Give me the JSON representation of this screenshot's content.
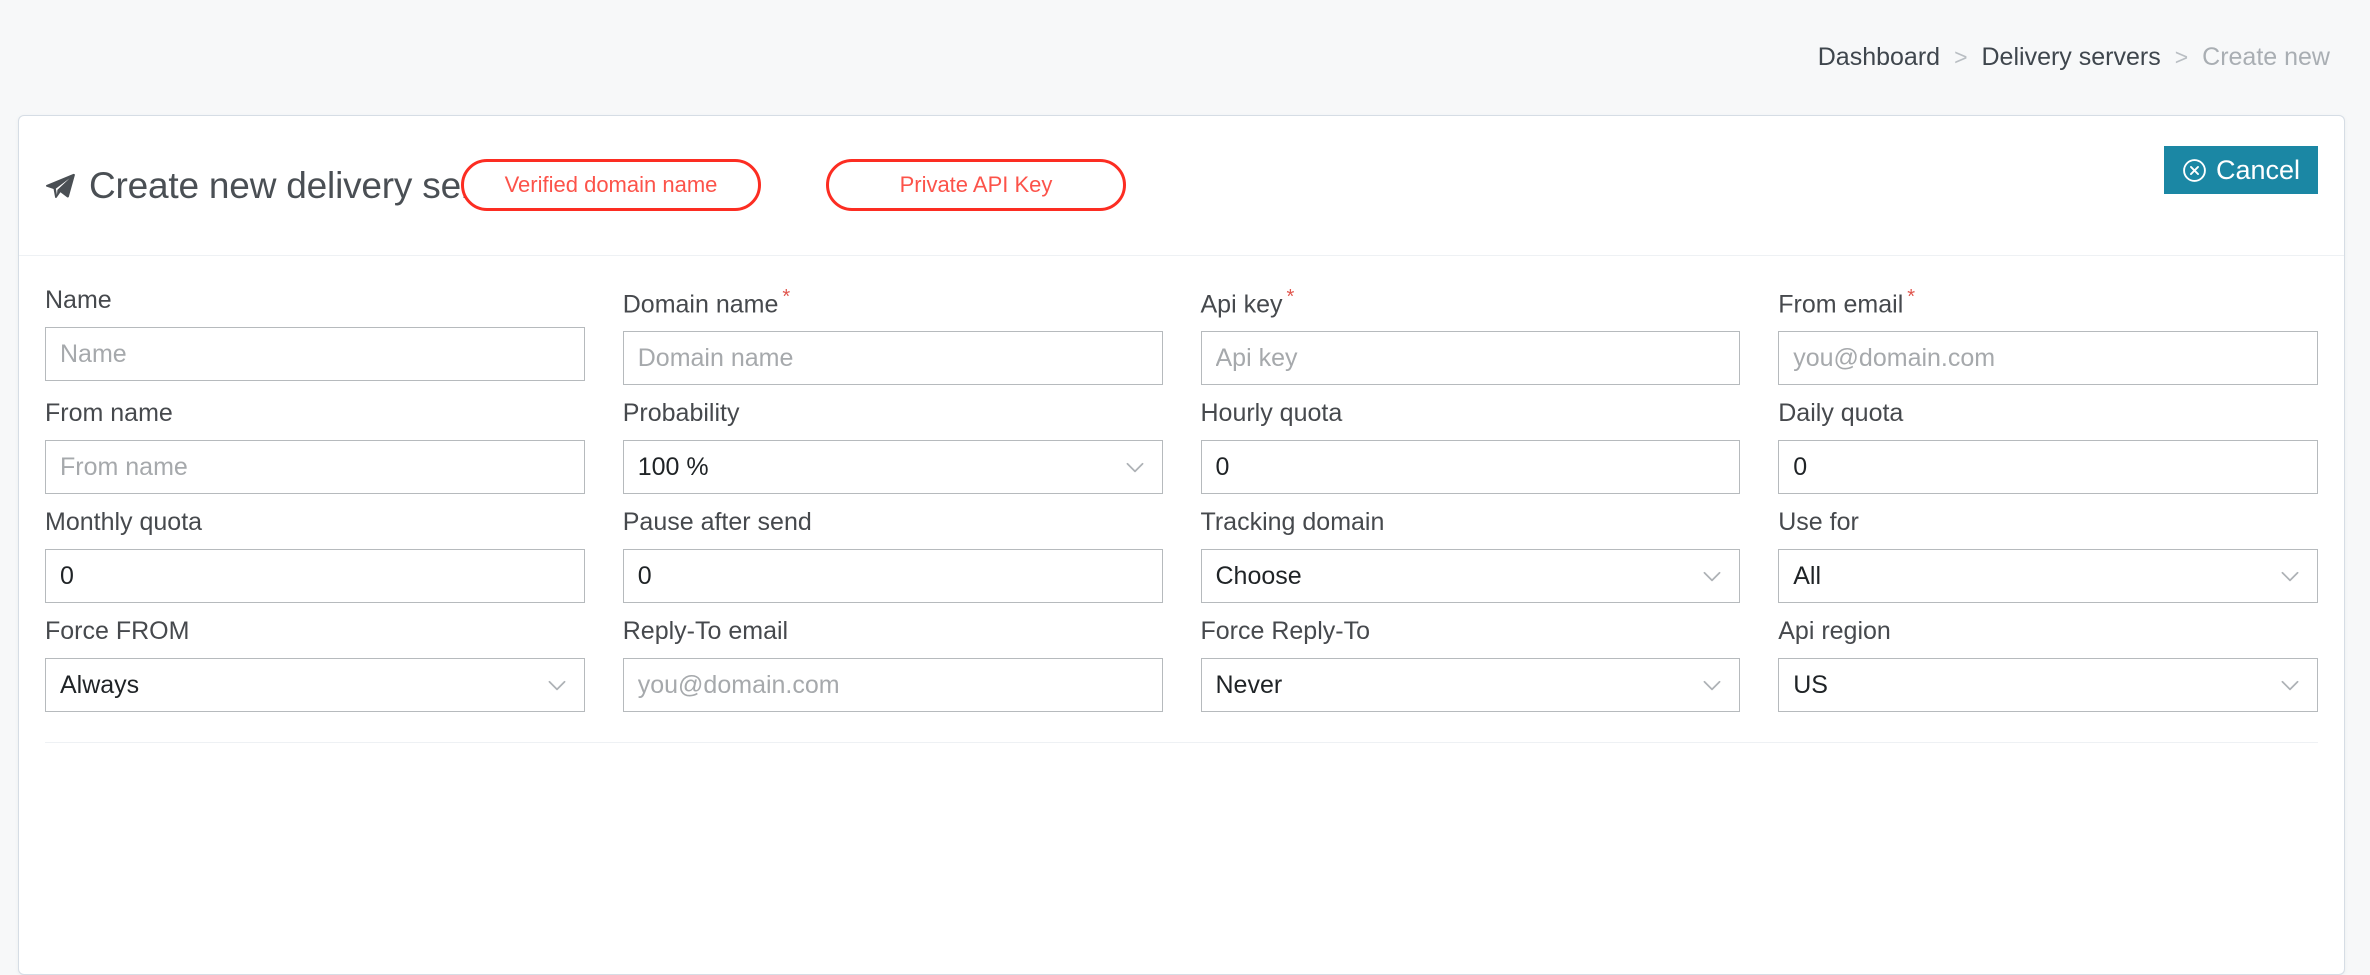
{
  "breadcrumb": {
    "items": [
      {
        "label": "Dashboard",
        "current": false
      },
      {
        "label": "Delivery servers",
        "current": false
      },
      {
        "label": "Create new",
        "current": true
      }
    ],
    "separator": ">"
  },
  "header": {
    "title": "Create new delivery server",
    "icon": "paper-plane-icon",
    "pills": [
      {
        "label": "Verified domain name",
        "name": "verified-domain-name-button"
      },
      {
        "label": "Private API Key",
        "name": "private-api-key-button"
      }
    ],
    "cancel": {
      "label": "Cancel",
      "icon": "circle-x-icon"
    }
  },
  "colors": {
    "accent_teal": "#1b87a4",
    "pill_border_red": "#fc2d22",
    "pill_text_red": "#fc534a",
    "required_red": "#e0554d",
    "page_background": "#f7f8f9",
    "card_border": "#d6dde5",
    "input_border": "#b6babd"
  },
  "form": {
    "rows": [
      [
        {
          "label": "Name",
          "required": false,
          "type": "text",
          "value": "",
          "placeholder": "Name",
          "name": "name"
        },
        {
          "label": "Domain name",
          "required": true,
          "type": "text",
          "value": "",
          "placeholder": "Domain name",
          "name": "domain-name"
        },
        {
          "label": "Api key",
          "required": true,
          "type": "text",
          "value": "",
          "placeholder": "Api key",
          "name": "api-key"
        },
        {
          "label": "From email",
          "required": true,
          "type": "text",
          "value": "",
          "placeholder": "you@domain.com",
          "name": "from-email"
        }
      ],
      [
        {
          "label": "From name",
          "required": false,
          "type": "text",
          "value": "",
          "placeholder": "From name",
          "name": "from-name"
        },
        {
          "label": "Probability",
          "required": false,
          "type": "select",
          "value": "100 %",
          "name": "probability"
        },
        {
          "label": "Hourly quota",
          "required": false,
          "type": "text",
          "value": "0",
          "placeholder": "",
          "name": "hourly-quota"
        },
        {
          "label": "Daily quota",
          "required": false,
          "type": "text",
          "value": "0",
          "placeholder": "",
          "name": "daily-quota"
        }
      ],
      [
        {
          "label": "Monthly quota",
          "required": false,
          "type": "text",
          "value": "0",
          "placeholder": "",
          "name": "monthly-quota"
        },
        {
          "label": "Pause after send",
          "required": false,
          "type": "text",
          "value": "0",
          "placeholder": "",
          "name": "pause-after-send"
        },
        {
          "label": "Tracking domain",
          "required": false,
          "type": "select",
          "value": "Choose",
          "name": "tracking-domain"
        },
        {
          "label": "Use for",
          "required": false,
          "type": "select",
          "value": "All",
          "name": "use-for"
        }
      ],
      [
        {
          "label": "Force FROM",
          "required": false,
          "type": "select",
          "value": "Always",
          "name": "force-from"
        },
        {
          "label": "Reply-To email",
          "required": false,
          "type": "text",
          "value": "",
          "placeholder": "you@domain.com",
          "name": "reply-to-email"
        },
        {
          "label": "Force Reply-To",
          "required": false,
          "type": "select",
          "value": "Never",
          "name": "force-reply-to"
        },
        {
          "label": "Api region",
          "required": false,
          "type": "select",
          "value": "US",
          "name": "api-region"
        }
      ]
    ]
  }
}
